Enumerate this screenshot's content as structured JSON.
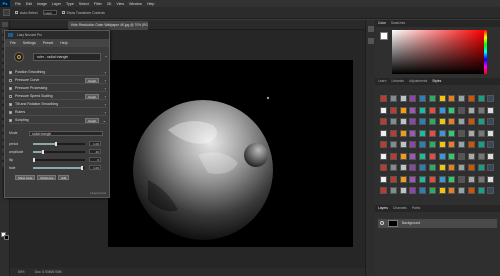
{
  "app": {
    "logo": "Ps",
    "menu": [
      "File",
      "Edit",
      "Image",
      "Layer",
      "Type",
      "Select",
      "Filter",
      "3D",
      "View",
      "Window",
      "Help"
    ]
  },
  "options": {
    "auto_select_label": "Auto-Select",
    "layer_dropdown": "Layer",
    "transform_label": "Show Transform Controls"
  },
  "doc": {
    "tab_title": "Hide Resolution Outer Wallpaper 4K.jpg @ 70% (RGB/8)"
  },
  "status": {
    "zoom": "50%",
    "info": "Doc: 5.93M/5.93M"
  },
  "plugin": {
    "title": "Lazy Nezumi Pro",
    "menu": [
      "File",
      "Settings",
      "Preset",
      "Help"
    ],
    "preset": "ruler - radial triangle",
    "rows": [
      {
        "label": "Position Smoothing",
        "checked": true,
        "button": ""
      },
      {
        "label": "Pressure Curve",
        "checked": false,
        "button": "Graph"
      },
      {
        "label": "Pressure Processing",
        "checked": true,
        "button": ""
      },
      {
        "label": "Pressure Speed Scaling",
        "checked": false,
        "button": "Graph"
      },
      {
        "label": "Tilt and Rotation Smoothing",
        "checked": true,
        "button": ""
      },
      {
        "label": "Rulers",
        "checked": true,
        "button": ""
      },
      {
        "label": "Scripting",
        "checked": true,
        "button": "Graph"
      }
    ],
    "mode_label": "Mode",
    "mode_value": "radial triangle",
    "params": [
      {
        "label": "period",
        "value": "1.00",
        "level": 0.45
      },
      {
        "label": "amplitude",
        "value": "40",
        "level": 0.2
      },
      {
        "label": "flip",
        "value": "0",
        "level": 0.0
      },
      {
        "label": "fade",
        "value": "1.00",
        "level": 0.95
      }
    ],
    "actions": [
      "Show Code",
      "Reference",
      "Edit"
    ],
    "footer": "Lazynezumi"
  },
  "panels": {
    "color_tabs": [
      "Color",
      "Swatches"
    ],
    "style_tabs": [
      "Learn",
      "Libraries",
      "Adjustments",
      "Styles"
    ],
    "layer_tabs": [
      "Layers",
      "Channels",
      "Paths"
    ],
    "layer_name": "Background"
  }
}
